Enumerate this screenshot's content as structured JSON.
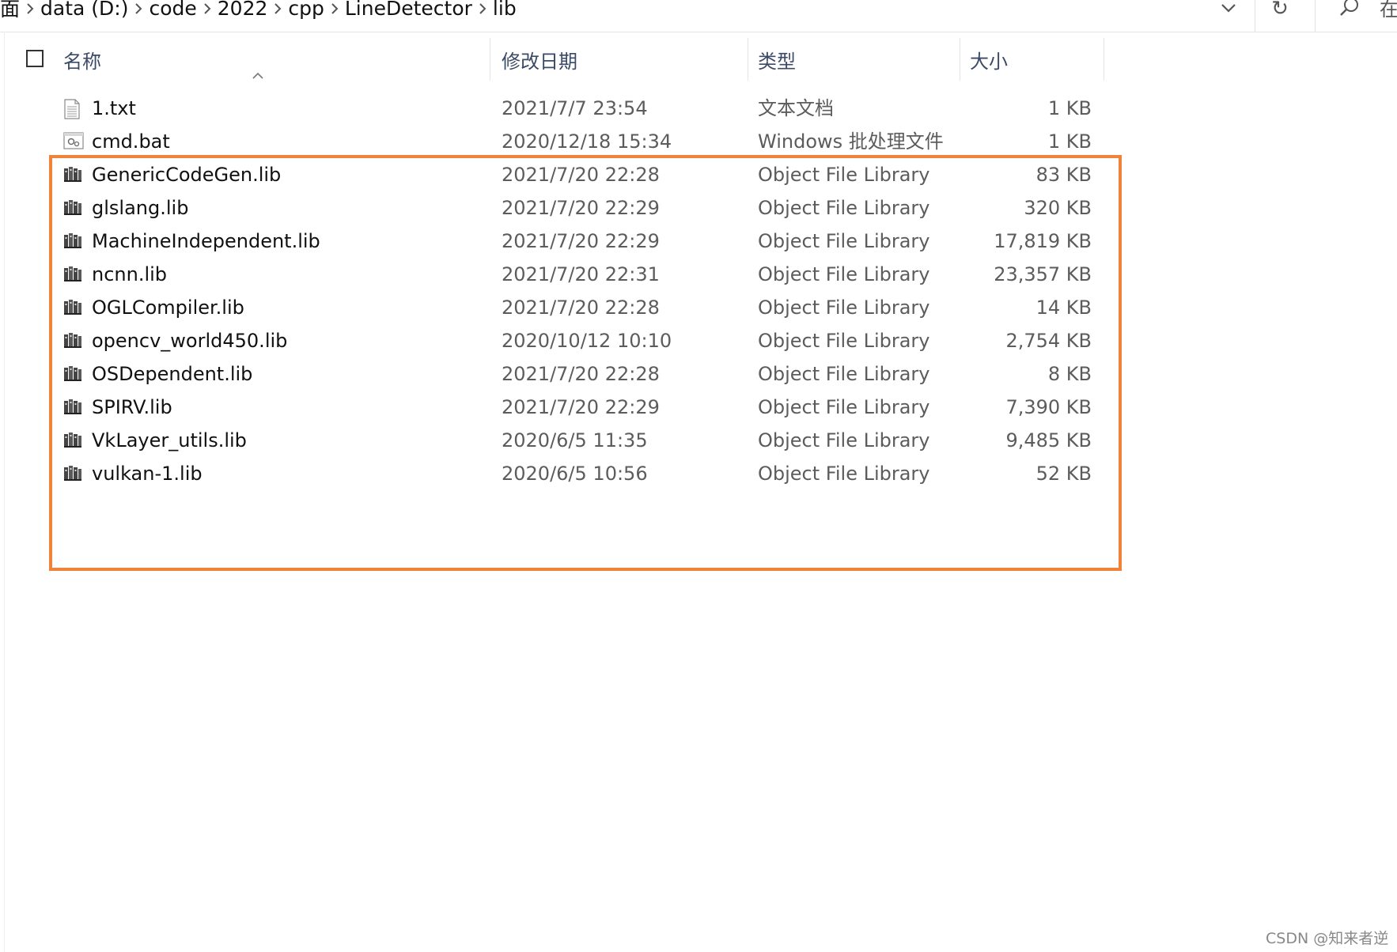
{
  "breadcrumb": {
    "items": [
      "面",
      "data (D:)",
      "code",
      "2022",
      "cpp",
      "LineDetector",
      "lib"
    ]
  },
  "search": {
    "placeholder": "在"
  },
  "refresh_glyph": "↻",
  "columns": {
    "name": "名称",
    "date": "修改日期",
    "type": "类型",
    "size": "大小"
  },
  "files": [
    {
      "name": "1.txt",
      "date": "2021/7/7 23:54",
      "type": "文本文档",
      "size": "1 KB",
      "icon": "text-file-icon"
    },
    {
      "name": "cmd.bat",
      "date": "2020/12/18 15:34",
      "type": "Windows 批处理文件",
      "size": "1 KB",
      "icon": "batch-file-icon"
    },
    {
      "name": "GenericCodeGen.lib",
      "date": "2021/7/20 22:28",
      "type": "Object File Library",
      "size": "83 KB",
      "icon": "library-file-icon"
    },
    {
      "name": "glslang.lib",
      "date": "2021/7/20 22:29",
      "type": "Object File Library",
      "size": "320 KB",
      "icon": "library-file-icon"
    },
    {
      "name": "MachineIndependent.lib",
      "date": "2021/7/20 22:29",
      "type": "Object File Library",
      "size": "17,819 KB",
      "icon": "library-file-icon"
    },
    {
      "name": "ncnn.lib",
      "date": "2021/7/20 22:31",
      "type": "Object File Library",
      "size": "23,357 KB",
      "icon": "library-file-icon"
    },
    {
      "name": "OGLCompiler.lib",
      "date": "2021/7/20 22:28",
      "type": "Object File Library",
      "size": "14 KB",
      "icon": "library-file-icon"
    },
    {
      "name": "opencv_world450.lib",
      "date": "2020/10/12 10:10",
      "type": "Object File Library",
      "size": "2,754 KB",
      "icon": "library-file-icon"
    },
    {
      "name": "OSDependent.lib",
      "date": "2021/7/20 22:28",
      "type": "Object File Library",
      "size": "8 KB",
      "icon": "library-file-icon"
    },
    {
      "name": "SPIRV.lib",
      "date": "2021/7/20 22:29",
      "type": "Object File Library",
      "size": "7,390 KB",
      "icon": "library-file-icon"
    },
    {
      "name": "VkLayer_utils.lib",
      "date": "2020/6/5 11:35",
      "type": "Object File Library",
      "size": "9,485 KB",
      "icon": "library-file-icon"
    },
    {
      "name": "vulkan-1.lib",
      "date": "2020/6/5 10:56",
      "type": "Object File Library",
      "size": "52 KB",
      "icon": "library-file-icon"
    }
  ],
  "highlight_color": "#f0823a",
  "watermark": "CSDN @知来者逆"
}
